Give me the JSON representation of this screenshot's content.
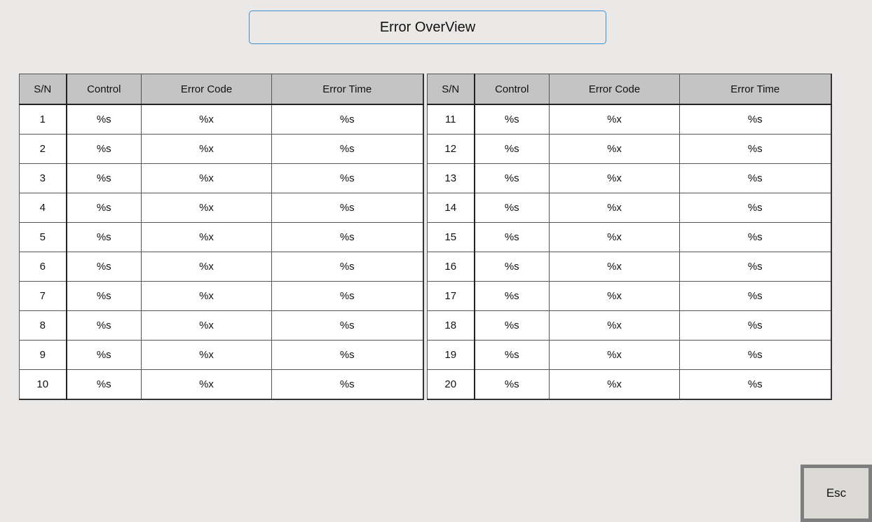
{
  "title": "Error OverView",
  "columns": [
    "S/N",
    "Control",
    "Error Code",
    "Error Time"
  ],
  "tables": [
    {
      "rows": [
        {
          "sn": "1",
          "control": "%s",
          "code": "%x",
          "time": "%s"
        },
        {
          "sn": "2",
          "control": "%s",
          "code": "%x",
          "time": "%s"
        },
        {
          "sn": "3",
          "control": "%s",
          "code": "%x",
          "time": "%s"
        },
        {
          "sn": "4",
          "control": "%s",
          "code": "%x",
          "time": "%s"
        },
        {
          "sn": "5",
          "control": "%s",
          "code": "%x",
          "time": "%s"
        },
        {
          "sn": "6",
          "control": "%s",
          "code": "%x",
          "time": "%s"
        },
        {
          "sn": "7",
          "control": "%s",
          "code": "%x",
          "time": "%s"
        },
        {
          "sn": "8",
          "control": "%s",
          "code": "%x",
          "time": "%s"
        },
        {
          "sn": "9",
          "control": "%s",
          "code": "%x",
          "time": "%s"
        },
        {
          "sn": "10",
          "control": "%s",
          "code": "%x",
          "time": "%s"
        }
      ]
    },
    {
      "rows": [
        {
          "sn": "11",
          "control": "%s",
          "code": "%x",
          "time": "%s"
        },
        {
          "sn": "12",
          "control": "%s",
          "code": "%x",
          "time": "%s"
        },
        {
          "sn": "13",
          "control": "%s",
          "code": "%x",
          "time": "%s"
        },
        {
          "sn": "14",
          "control": "%s",
          "code": "%x",
          "time": "%s"
        },
        {
          "sn": "15",
          "control": "%s",
          "code": "%x",
          "time": "%s"
        },
        {
          "sn": "16",
          "control": "%s",
          "code": "%x",
          "time": "%s"
        },
        {
          "sn": "17",
          "control": "%s",
          "code": "%x",
          "time": "%s"
        },
        {
          "sn": "18",
          "control": "%s",
          "code": "%x",
          "time": "%s"
        },
        {
          "sn": "19",
          "control": "%s",
          "code": "%x",
          "time": "%s"
        },
        {
          "sn": "20",
          "control": "%s",
          "code": "%x",
          "time": "%s"
        }
      ]
    }
  ],
  "esc_label": "Esc",
  "colors": {
    "background": "#ebe9e7",
    "header": "#c4c4c4",
    "title_border": "#3f8fd0"
  }
}
